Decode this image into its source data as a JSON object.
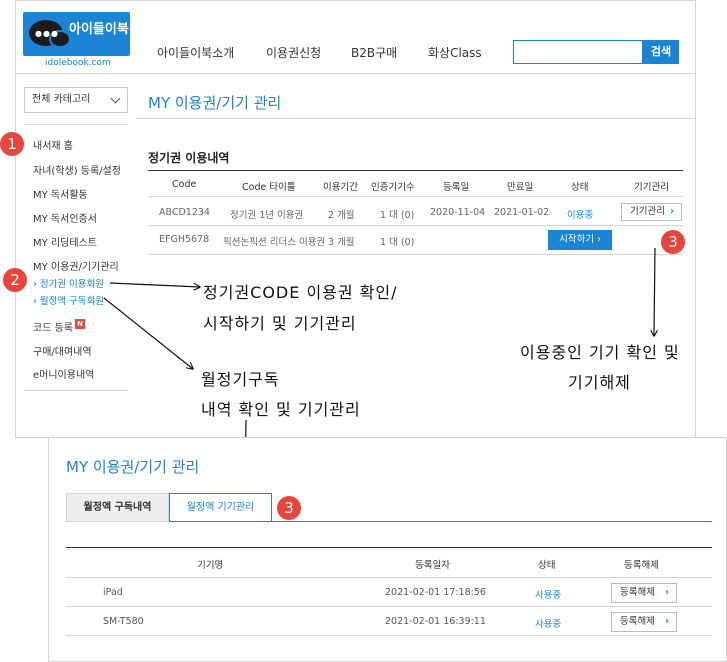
{
  "logo": {
    "title": "아이들이북",
    "url": "idolebook.com"
  },
  "nav": {
    "items": [
      "아이들이북소개",
      "이용권신청",
      "B2B구매",
      "화상Class"
    ],
    "search_button": "검색"
  },
  "sidebar": {
    "category": "전체 카테고리",
    "items": [
      "내서재 홈",
      "자녀(학생) 등록/설정",
      "MY 독서활동",
      "MY 독서인증서",
      "MY 리딩테스트",
      "MY 이용권/기기관리"
    ],
    "sub_items": [
      "› 정기권 이용회원",
      "› 월정액 구독회원"
    ],
    "items_after": [
      "코드 등록",
      "구매/대여내역",
      "e머니이용내역"
    ],
    "new_badge": "N"
  },
  "content": {
    "page_title": "MY 이용권/기기 관리",
    "section_title": "정기권 이용내역",
    "table": {
      "headers": [
        "Code",
        "Code 타이틀",
        "이용기간",
        "인증기기수",
        "등록일",
        "만료일",
        "상태",
        "기기관리"
      ],
      "rows": [
        [
          "ABCD1234",
          "정기권 1년 이용권",
          "2 개월",
          "1 대 (0)",
          "2020-11-04",
          "2021-01-02",
          "이용중",
          "기기관리"
        ],
        [
          "EFGH5678",
          "픽션논픽션 리더스 이용권",
          "3 개월",
          "1 대 (0)",
          "",
          "",
          "시작하기",
          ""
        ]
      ]
    }
  },
  "annotations": {
    "badges": [
      "1",
      "2",
      "3",
      "3",
      "3"
    ],
    "note_1_line1": "정기권CODE 이용권 확인/",
    "note_1_line2": "시작하기 및 기기관리",
    "note_2_line1": "월정기구독",
    "note_2_line2": "내역 확인 및 기기관리",
    "note_3_line1": "이용중인 기기 확인 및",
    "note_3_line2": "기기해제"
  },
  "lower": {
    "title": "MY 이용권/기기 관리",
    "tabs": [
      "월정액 구독내역",
      "월정액 기기관리"
    ],
    "headers": [
      "기기명",
      "등록일자",
      "상태",
      "등록해제"
    ],
    "rows": [
      [
        "iPad",
        "2021-02-01 17:18:56",
        "사용중",
        "등록해제"
      ],
      [
        "SM-T580",
        "2021-02-01 16:39:11",
        "사용중",
        "등록해제"
      ]
    ]
  },
  "colors": {
    "accent": "#1b84d4",
    "badge": "#e8453c"
  }
}
